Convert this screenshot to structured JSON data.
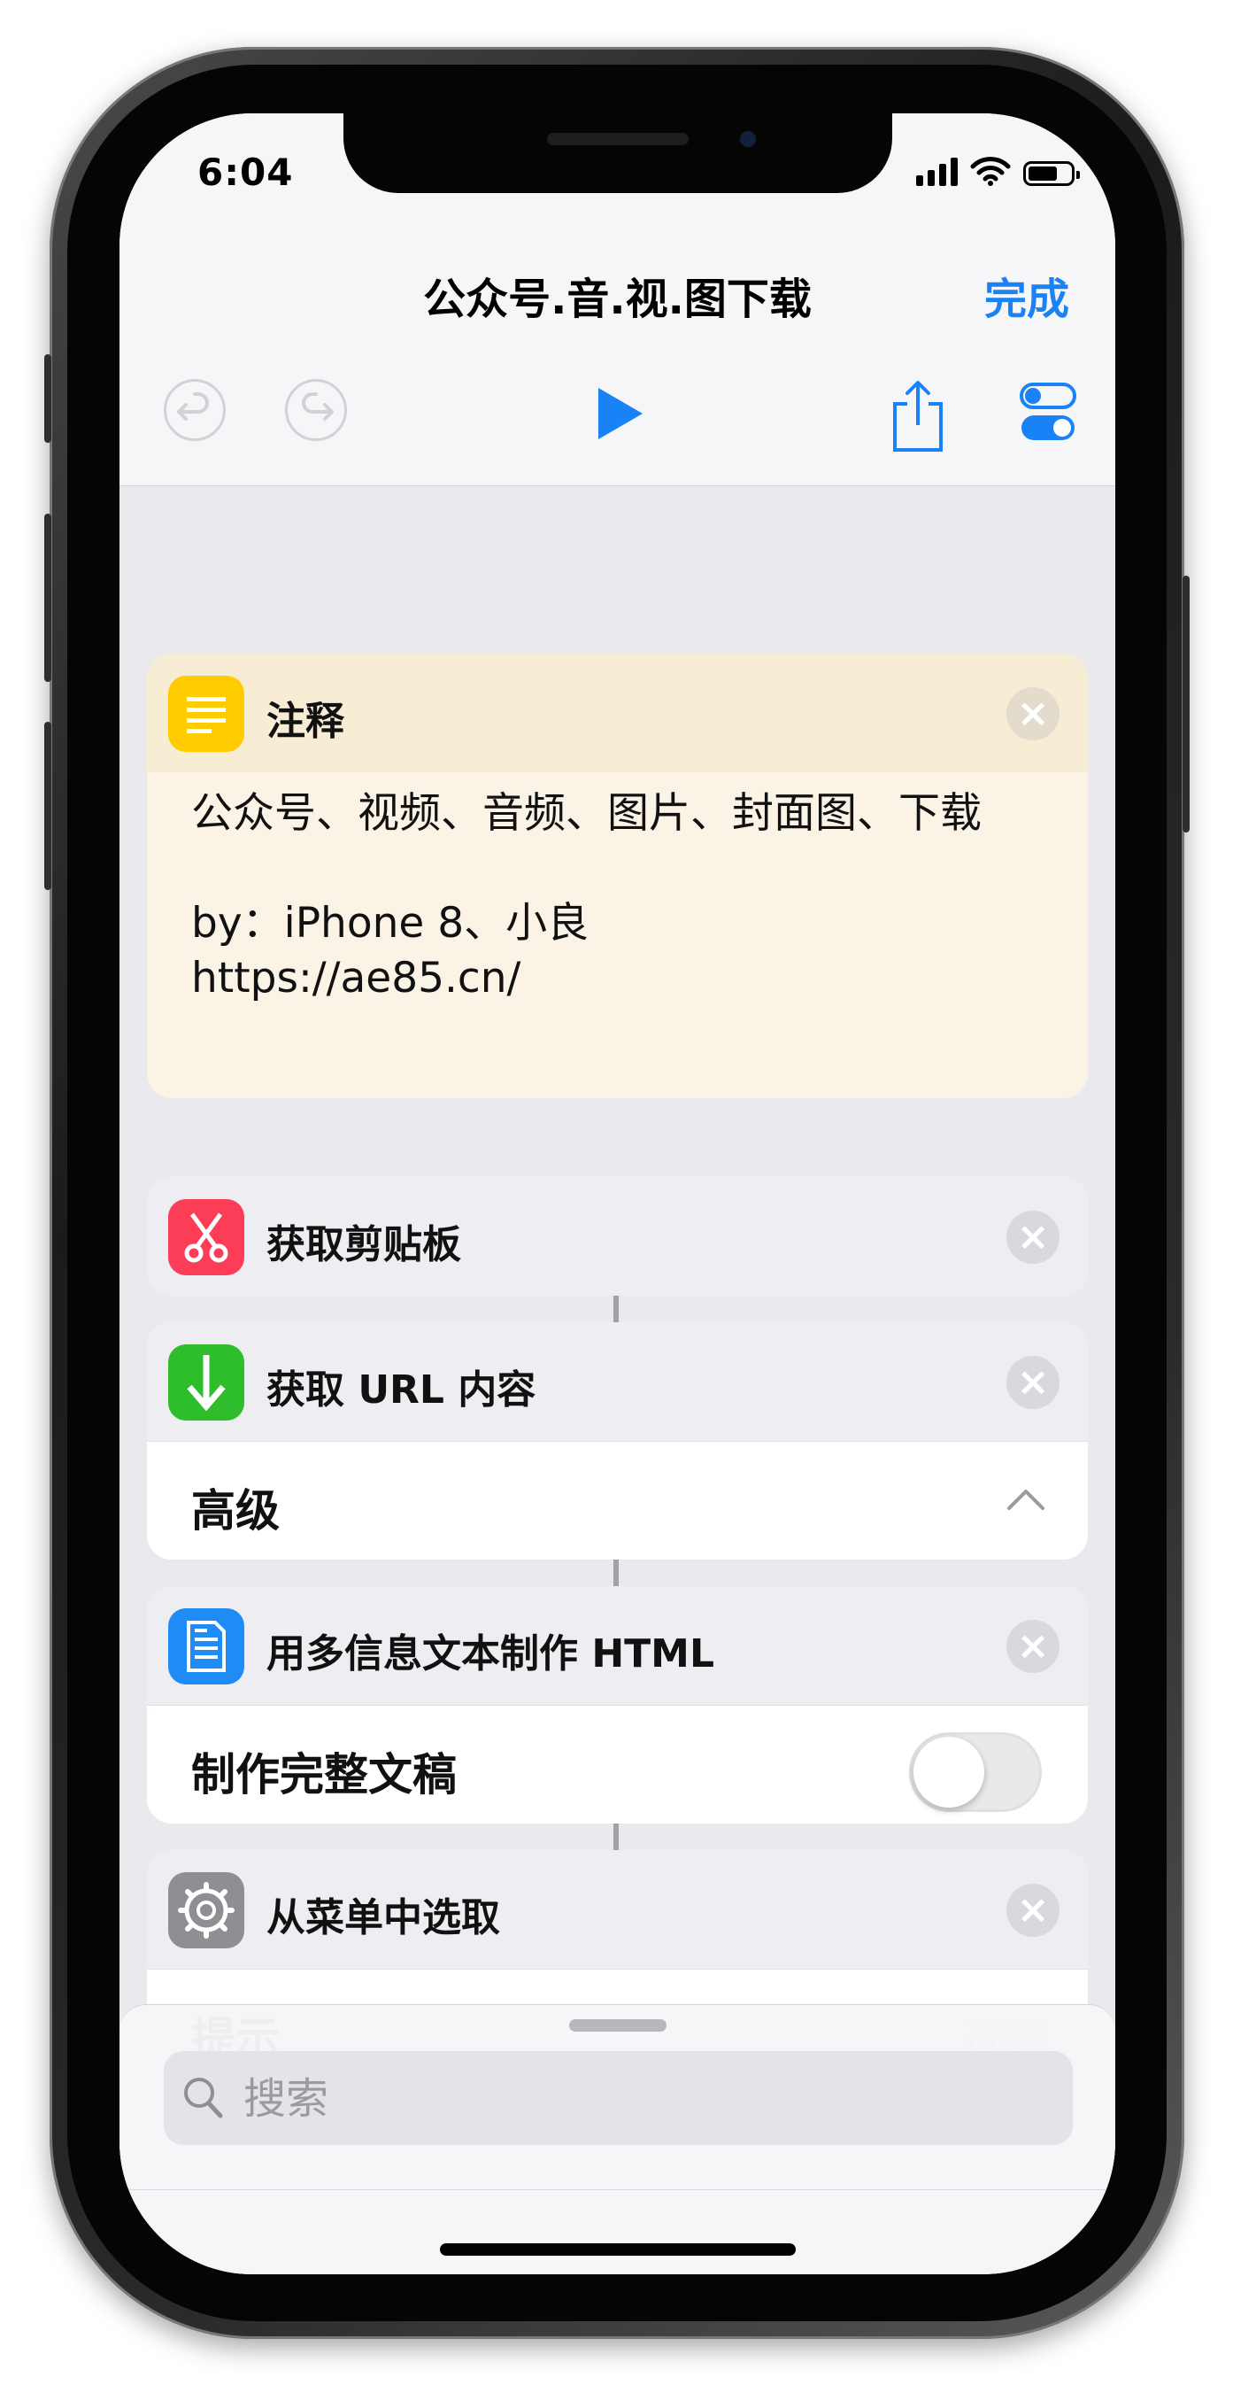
{
  "status": {
    "time": "6:04"
  },
  "nav": {
    "title": "公众号.音.视.图下载",
    "done_label": "完成"
  },
  "actions": {
    "comment": {
      "title": "注释",
      "text": "公众号、视频、音频、图片、封面图、下载\n\nby：iPhone 8、小良\nhttps://ae85.cn/",
      "icon": "note-icon",
      "color": "#ffcc00"
    },
    "clipboard": {
      "title": "获取剪贴板",
      "icon": "scissors-icon",
      "color": "#fc3d57"
    },
    "get_url": {
      "title": "获取 URL 内容",
      "icon": "download-arrow-icon",
      "color": "#2ebd2b",
      "row_label": "高级"
    },
    "make_html": {
      "title": "用多信息文本制作 HTML",
      "icon": "document-icon",
      "color": "#1f8cf5",
      "row_label": "制作完整文稿",
      "toggle_on": false
    },
    "choose_menu": {
      "title": "从菜单中选取",
      "icon": "gear-icon",
      "color": "#8e8e93",
      "row_label": "提示",
      "row_placeholder": "选填"
    }
  },
  "search": {
    "placeholder": "搜索"
  },
  "colors": {
    "accent": "#1a82f7"
  }
}
